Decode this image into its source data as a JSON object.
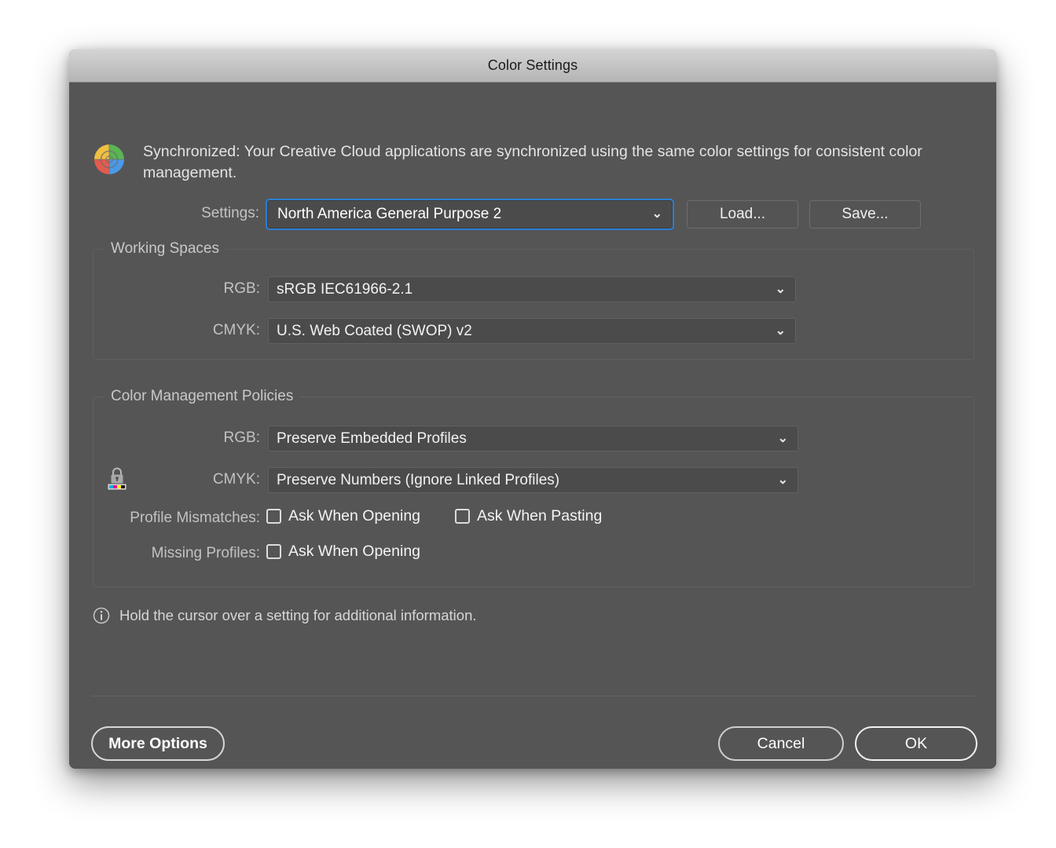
{
  "window": {
    "title": "Color Settings"
  },
  "sync": {
    "icon": "creative-cloud-color-wheel-icon",
    "message": "Synchronized: Your Creative Cloud applications are synchronized using the same color settings for consistent color management."
  },
  "settings": {
    "label": "Settings:",
    "value": "North America General Purpose 2",
    "chevron": "⌄",
    "load_label": "Load...",
    "save_label": "Save..."
  },
  "working_spaces": {
    "title": "Working Spaces",
    "rows": [
      {
        "label": "RGB:",
        "value": "sRGB IEC61966‑2.1",
        "chevron": "⌄"
      },
      {
        "label": "CMYK:",
        "value": "U.S. Web Coated (SWOP) v2",
        "chevron": "⌄"
      }
    ]
  },
  "policies": {
    "title": "Color Management Policies",
    "rows": [
      {
        "label": "RGB:",
        "value": "Preserve Embedded Profiles",
        "chevron": "⌄"
      },
      {
        "label": "CMYK:",
        "value": "Preserve Numbers (Ignore Linked Profiles)",
        "chevron": "⌄"
      }
    ],
    "lock_icon": "lock-cmyk-swatch-icon",
    "profile_mismatches": {
      "label": "Profile Mismatches:",
      "ask_when_opening": "Ask When Opening",
      "ask_when_opening_checked": false,
      "ask_when_pasting": "Ask When Pasting",
      "ask_when_pasting_checked": false
    },
    "missing_profiles": {
      "label": "Missing Profiles:",
      "ask_when_opening": "Ask When Opening",
      "ask_when_opening_checked": false
    }
  },
  "hint": {
    "icon": "info-circle-icon",
    "text": "Hold the cursor over a setting for additional information."
  },
  "footer": {
    "more_options_label": "More Options",
    "cancel_label": "Cancel",
    "ok_label": "OK"
  },
  "colors": {
    "dialog_background": "#555555",
    "titlebar": "#c6c6c6",
    "focus_ring": "#2b7fd4",
    "field_background": "#4b4b4b",
    "text_primary": "#f2f2f2",
    "text_secondary": "#c2c2c2",
    "swatch_cyan": "#00aeef",
    "swatch_magenta": "#ec008c",
    "swatch_yellow": "#fff200",
    "swatch_black": "#1a1a1a",
    "wheel_yellow": "#f0c040",
    "wheel_green": "#5ab552",
    "wheel_red": "#e35b4f",
    "wheel_blue": "#4b9ae8"
  }
}
